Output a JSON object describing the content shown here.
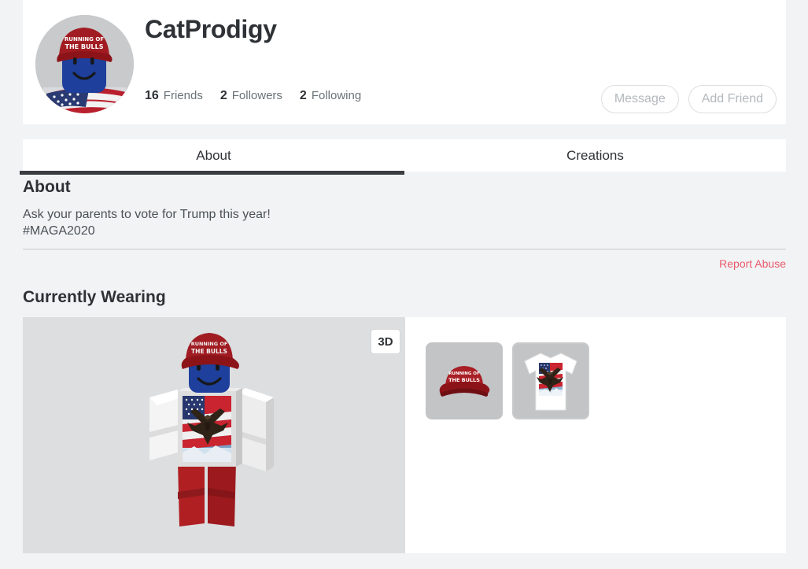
{
  "profile": {
    "username": "CatProdigy",
    "avatar_icon": "avatar-headshot",
    "stats": [
      {
        "count": "16",
        "label": "Friends"
      },
      {
        "count": "2",
        "label": "Followers"
      },
      {
        "count": "2",
        "label": "Following"
      }
    ],
    "actions": [
      {
        "label": "Message",
        "name": "message-button",
        "disabled": true
      },
      {
        "label": "Add Friend",
        "name": "add-friend-button",
        "disabled": true
      }
    ]
  },
  "tabs": [
    {
      "label": "About",
      "active": true
    },
    {
      "label": "Creations",
      "active": false
    }
  ],
  "about": {
    "heading": "About",
    "description": "Ask your parents to vote for Trump this year!\n#MAGA2020",
    "report_abuse": "Report Abuse"
  },
  "currently_wearing": {
    "heading": "Currently Wearing",
    "view_toggle": "3D",
    "items": [
      {
        "name": "running-of-the-bulls-cap",
        "tile_style": "gray"
      },
      {
        "name": "american-flag-eagle-shirt",
        "tile_style": "bordered"
      }
    ]
  },
  "colors": {
    "page_background": "#f2f3f5",
    "card_background": "#ffffff",
    "text_primary": "#2e3135",
    "text_secondary": "#6b7378",
    "accent_report": "#e8596a",
    "tab_underline": "#3b3d41",
    "viewport_background": "#dcdee0"
  }
}
